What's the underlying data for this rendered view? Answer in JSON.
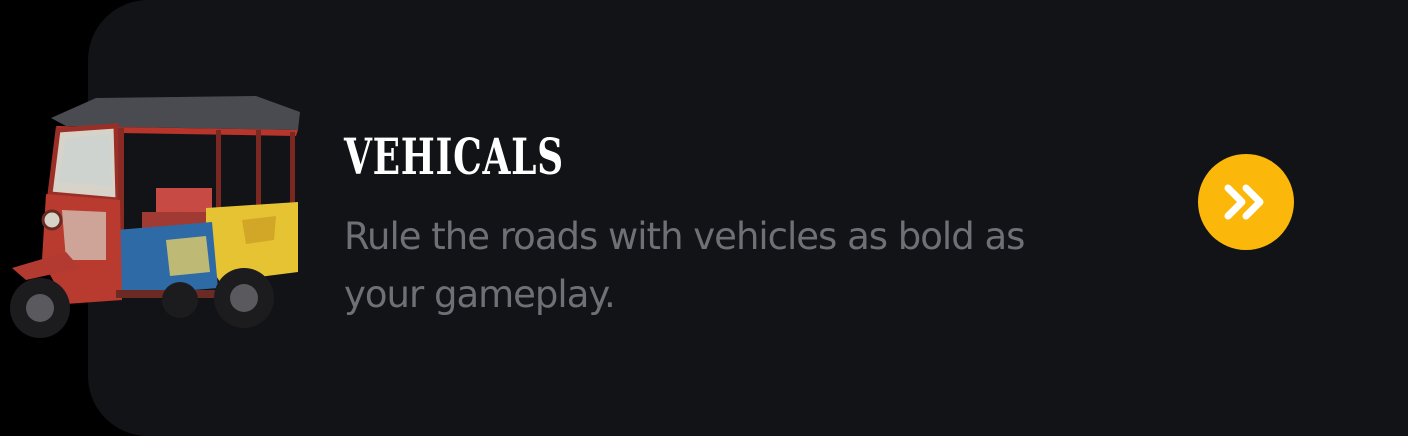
{
  "card": {
    "title": "VEHICALS",
    "description": "Rule the roads with vehicles as bold as your gameplay.",
    "image": "tuk-tuk-vehicle",
    "action_icon": "double-chevron-right-icon"
  },
  "colors": {
    "background": "#121317",
    "title": "#ffffff",
    "description": "#6f7075",
    "accent": "#fbb80a"
  }
}
